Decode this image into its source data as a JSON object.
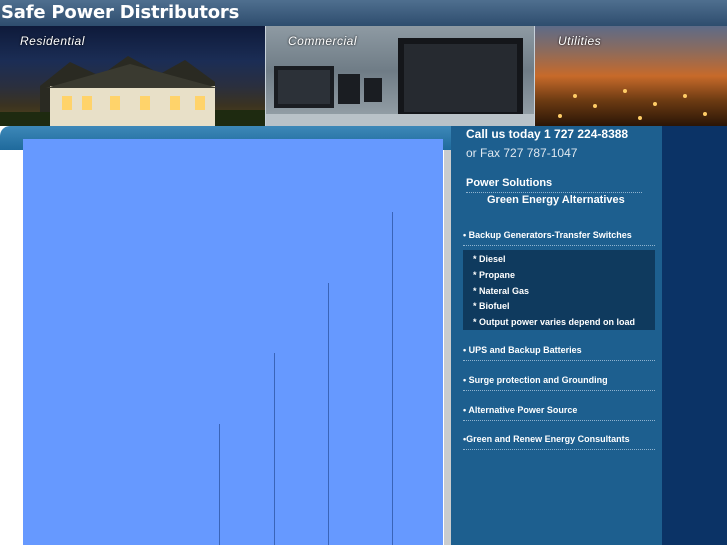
{
  "header": {
    "title": "Safe Power Distributors"
  },
  "banner": {
    "residential": "Residential",
    "commercial": "Commercial",
    "utilities": "Utilities"
  },
  "contact": {
    "call": "Call us today 1 727 224-8388",
    "fax": "or Fax 727 787-1047"
  },
  "nav": {
    "power_solutions": "Power Solutions",
    "green_energy": "Green Energy Alternatives",
    "backup": "• Backup Generators-Transfer Switches",
    "sub_items": [
      "* Diesel",
      "* Propane",
      "* Nateral Gas",
      "* Biofuel",
      "* Output power varies depend on load"
    ],
    "ups": "• UPS and Backup Batteries",
    "surge": "• Surge protection and Grounding",
    "alternative": "• Alternative Power Source",
    "consultants": "•Green and Renew Energy Consultants"
  },
  "colors": {
    "header": "#3d5d7e",
    "sidebar": "#1d5f8f",
    "content_box": "#6699ff",
    "far_right": "#0b3366"
  }
}
